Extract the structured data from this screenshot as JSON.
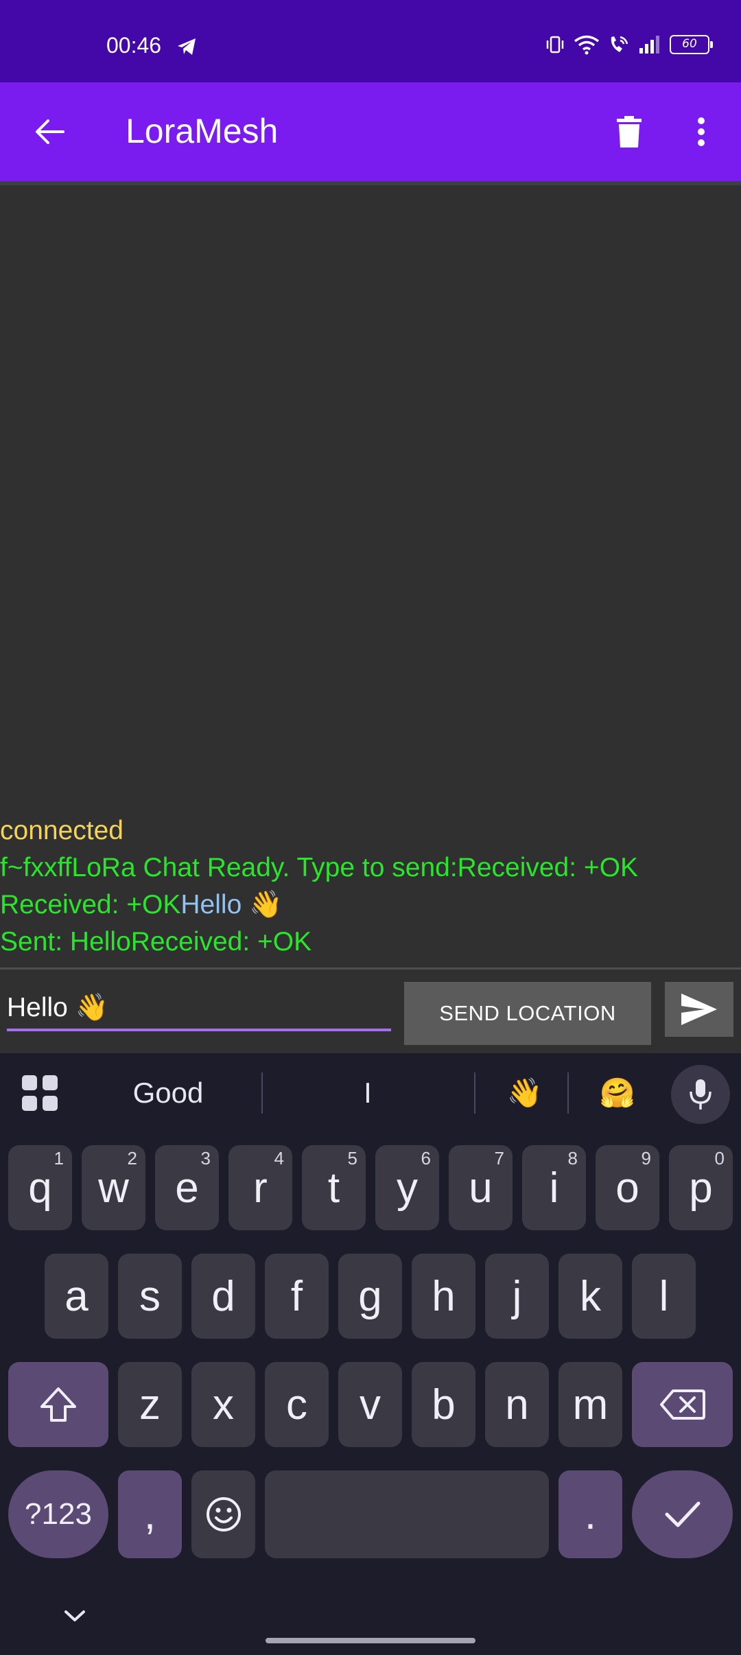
{
  "status_bar": {
    "time": "00:46",
    "battery": "60",
    "icons": [
      "telegram-icon",
      "vibrate-icon",
      "wifi-icon",
      "wifi-call-icon",
      "signal-icon",
      "battery-icon"
    ]
  },
  "app_bar": {
    "title": "LoraMesh",
    "icons": [
      "back-arrow-icon",
      "trash-icon",
      "more-vert-icon"
    ]
  },
  "chat": {
    "line1": "connected",
    "line2": "f~fxxffLoRa Chat Ready. Type to send:Received: +OK",
    "line3_green": "Received: +OK",
    "line3_blue": "Hello 👋",
    "line4": "Sent: HelloReceived: +OK"
  },
  "input": {
    "value": "Hello 👋",
    "send_location_label": "SEND LOCATION"
  },
  "keyboard": {
    "suggestions": [
      "Good",
      "I",
      "👋",
      "🤗"
    ],
    "row1": [
      {
        "k": "q",
        "h": "1"
      },
      {
        "k": "w",
        "h": "2"
      },
      {
        "k": "e",
        "h": "3"
      },
      {
        "k": "r",
        "h": "4"
      },
      {
        "k": "t",
        "h": "5"
      },
      {
        "k": "y",
        "h": "6"
      },
      {
        "k": "u",
        "h": "7"
      },
      {
        "k": "i",
        "h": "8"
      },
      {
        "k": "o",
        "h": "9"
      },
      {
        "k": "p",
        "h": "0"
      }
    ],
    "row2": [
      "a",
      "s",
      "d",
      "f",
      "g",
      "h",
      "j",
      "k",
      "l"
    ],
    "row3": [
      "z",
      "x",
      "c",
      "v",
      "b",
      "n",
      "m"
    ],
    "symbols_label": "?123",
    "comma": ",",
    "period": "."
  },
  "colors": {
    "status_bar": "#4508a8",
    "app_bar": "#7a1cf0",
    "chat_bg": "#303030",
    "yellow_text": "#f3d35a",
    "green_text": "#29e52b",
    "blue_text": "#8fc3f2",
    "keyboard_bg": "#1d1c2a"
  }
}
